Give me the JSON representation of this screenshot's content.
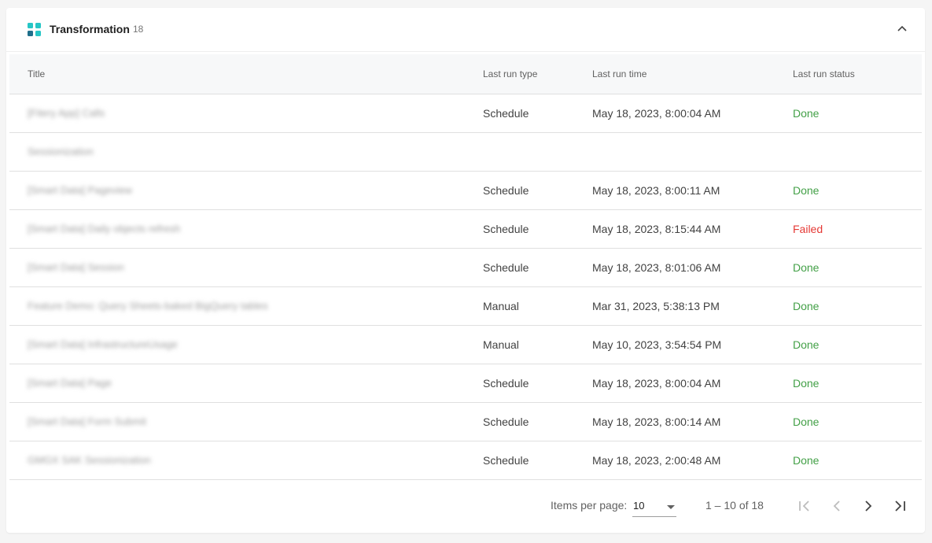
{
  "header": {
    "title": "Transformation",
    "count": "18"
  },
  "table": {
    "columns": [
      "Title",
      "Last run type",
      "Last run time",
      "Last run status"
    ],
    "rows": [
      {
        "title": "[Fitery App] Calls",
        "type": "Schedule",
        "time": "May 18, 2023, 8:00:04 AM",
        "status": "Done"
      },
      {
        "title": "Sessionization",
        "type": "",
        "time": "",
        "status": ""
      },
      {
        "title": "[Smart Data] Pageview",
        "type": "Schedule",
        "time": "May 18, 2023, 8:00:11 AM",
        "status": "Done"
      },
      {
        "title": "[Smart Data] Daily objects refresh",
        "type": "Schedule",
        "time": "May 18, 2023, 8:15:44 AM",
        "status": "Failed"
      },
      {
        "title": "[Smart Data] Session",
        "type": "Schedule",
        "time": "May 18, 2023, 8:01:06 AM",
        "status": "Done"
      },
      {
        "title": "Feature Demo: Query Sheets-baked BigQuery tables",
        "type": "Manual",
        "time": "Mar 31, 2023, 5:38:13 PM",
        "status": "Done"
      },
      {
        "title": "[Smart Data] InfrastructureUsage",
        "type": "Manual",
        "time": "May 10, 2023, 3:54:54 PM",
        "status": "Done"
      },
      {
        "title": "[Smart Data] Page",
        "type": "Schedule",
        "time": "May 18, 2023, 8:00:04 AM",
        "status": "Done"
      },
      {
        "title": "[Smart Data] Form Submit",
        "type": "Schedule",
        "time": "May 18, 2023, 8:00:14 AM",
        "status": "Done"
      },
      {
        "title": "GMGX SAK Sessionization",
        "type": "Schedule",
        "time": "May 18, 2023, 2:00:48 AM",
        "status": "Done"
      }
    ]
  },
  "paginator": {
    "items_per_page_label": "Items per page:",
    "items_per_page_value": "10",
    "range_label": "1 – 10 of 18"
  },
  "colors": {
    "done": "#43a047",
    "failed": "#e53935",
    "logo_teal": "#26c6c6",
    "logo_dark": "#1f6f8b"
  },
  "icons": {
    "logo": "transformation-logo-icon",
    "collapse": "chevron-up-icon",
    "first": "first-page-icon",
    "prev": "chevron-left-icon",
    "next": "chevron-right-icon",
    "last": "last-page-icon"
  }
}
